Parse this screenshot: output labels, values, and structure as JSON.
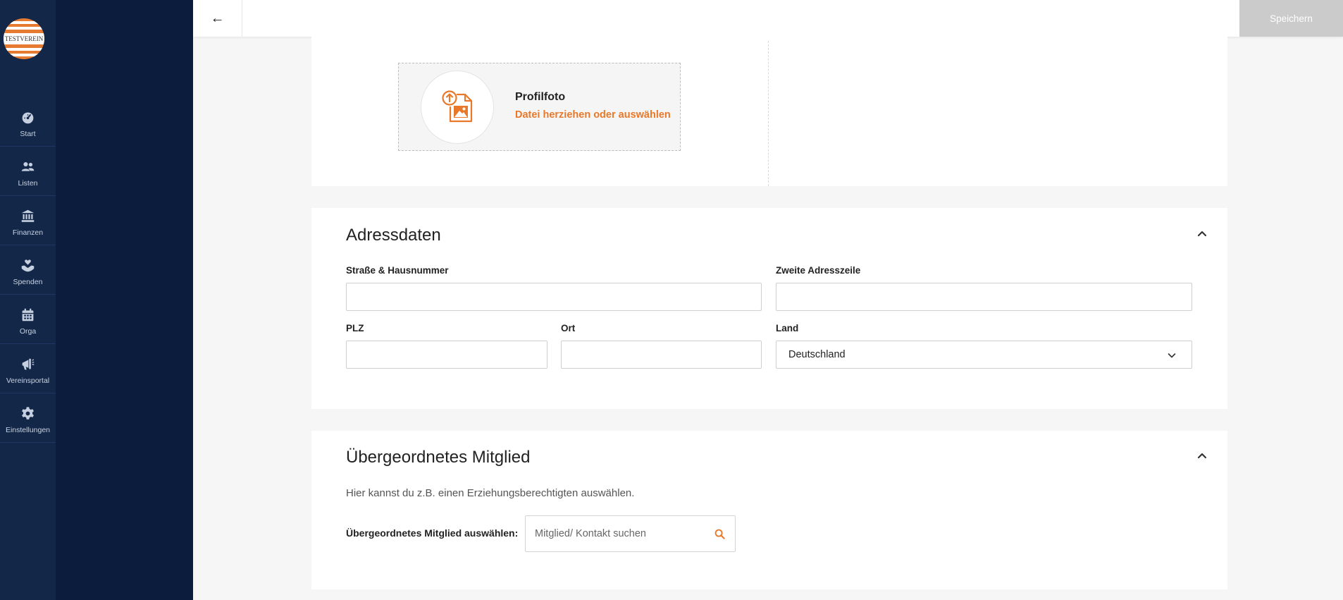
{
  "app": {
    "logo_text": "TESTVEREIN"
  },
  "nav": [
    {
      "id": "start",
      "label": "Start",
      "icon": "dashboard-icon"
    },
    {
      "id": "listen",
      "label": "Listen",
      "icon": "users-icon"
    },
    {
      "id": "finanzen",
      "label": "Finanzen",
      "icon": "bank-icon"
    },
    {
      "id": "spenden",
      "label": "Spenden",
      "icon": "donate-heart-icon"
    },
    {
      "id": "orga",
      "label": "Orga",
      "icon": "calendar-icon"
    },
    {
      "id": "vereinsportal",
      "label": "Vereinsportal",
      "icon": "megaphone-icon"
    },
    {
      "id": "einstellungen",
      "label": "Einstellungen",
      "icon": "gear-icon"
    }
  ],
  "topbar": {
    "back_label": "←",
    "save_label": "Speichern"
  },
  "profile_photo": {
    "title": "Profilfoto",
    "upload_link": "Datei herziehen oder auswählen"
  },
  "address": {
    "title": "Adressdaten",
    "street_label": "Straße & Hausnummer",
    "street_value": "",
    "line2_label": "Zweite Adresszeile",
    "line2_value": "",
    "zip_label": "PLZ",
    "zip_value": "",
    "city_label": "Ort",
    "city_value": "",
    "country_label": "Land",
    "country_value": "Deutschland"
  },
  "parent_member": {
    "title": "Übergeordnetes Mitglied",
    "hint": "Hier kannst du z.B. einen Erziehungsberechtigten auswählen.",
    "select_label": "Übergeordnetes Mitglied auswählen:",
    "search_placeholder": "Mitglied/ Kontakt suchen"
  },
  "colors": {
    "rail": "#132749",
    "panel": "#0b1c3d",
    "accent": "#e8782a",
    "save_disabled": "#cbcbcb"
  }
}
